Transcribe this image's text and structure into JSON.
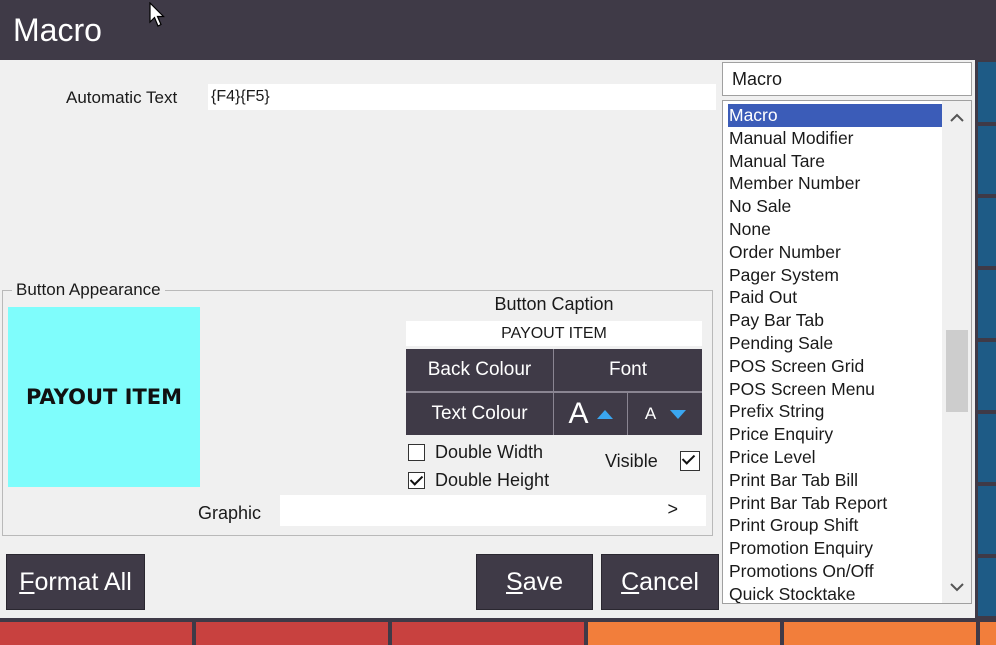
{
  "window": {
    "title": "Macro"
  },
  "automatic_text": {
    "label": "Automatic Text",
    "value": "{F4}{F5}"
  },
  "function_combo": {
    "value": "Macro"
  },
  "function_list": {
    "items": [
      "Macro",
      "Manual Modifier",
      "Manual Tare",
      "Member Number",
      "No Sale",
      "None",
      "Order Number",
      "Pager System",
      "Paid Out",
      "Pay Bar Tab",
      "Pending Sale",
      "POS Screen Grid",
      "POS Screen Menu",
      "Prefix String",
      "Price Enquiry",
      "Price Level",
      "Print Bar Tab Bill",
      "Print Bar Tab Report",
      "Print Group Shift",
      "Promotion Enquiry",
      "Promotions On/Off",
      "Quick Stocktake"
    ],
    "selected_index": 0,
    "up_icon": "chevron-up-icon",
    "down_icon": "chevron-down-icon"
  },
  "appearance": {
    "legend": "Button Appearance",
    "preview_text": "PAYOUT ITEM",
    "preview_color": "#7ffdfc",
    "caption_label": "Button Caption",
    "caption_value": "PAYOUT ITEM",
    "back_colour_label": "Back Colour",
    "font_label": "Font",
    "text_colour_label": "Text Colour",
    "font_increase_glyph": "A",
    "font_decrease_glyph": "A",
    "double_width": {
      "label": "Double Width",
      "checked": false
    },
    "double_height": {
      "label": "Double Height",
      "checked": true
    },
    "visible": {
      "label": "Visible",
      "checked": true
    },
    "graphic": {
      "label": "Graphic",
      "value": "",
      "browse": ">"
    }
  },
  "buttons": {
    "format_all": {
      "prefix": "",
      "mnemonic": "F",
      "rest": "ormat All"
    },
    "save": {
      "prefix": "",
      "mnemonic": "S",
      "rest": "ave"
    },
    "cancel": {
      "prefix": "",
      "mnemonic": "C",
      "rest": "ancel"
    }
  },
  "colors": {
    "titlebar": "#3f3a47",
    "dialog_bg": "#f0f0f0",
    "selection": "#3b5cb8",
    "accent_arrow": "#3aa6f0",
    "tile_red": "#c8413f",
    "tile_orange": "#f27e3b"
  }
}
